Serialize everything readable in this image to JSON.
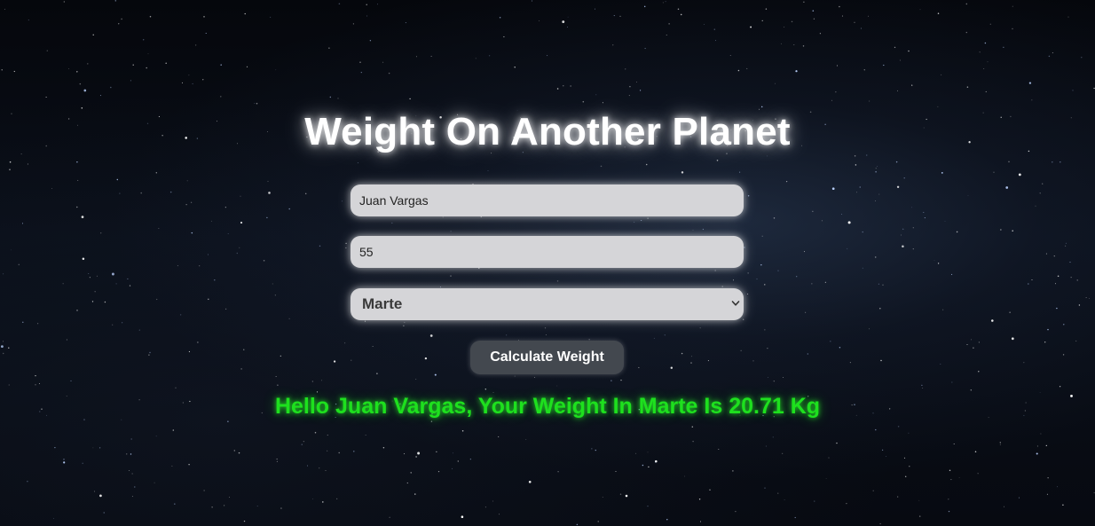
{
  "page": {
    "title": "Weight On Another Planet"
  },
  "form": {
    "name_value": "Juan Vargas",
    "weight_value": "55",
    "planet_selected": "Marte",
    "submit_label": "Calculate Weight"
  },
  "result": {
    "message": "Hello Juan Vargas, Your Weight In Marte Is 20.71 Kg",
    "color": "#1ee01e"
  },
  "icons": {
    "select_arrow": "chevron-down-icon"
  }
}
